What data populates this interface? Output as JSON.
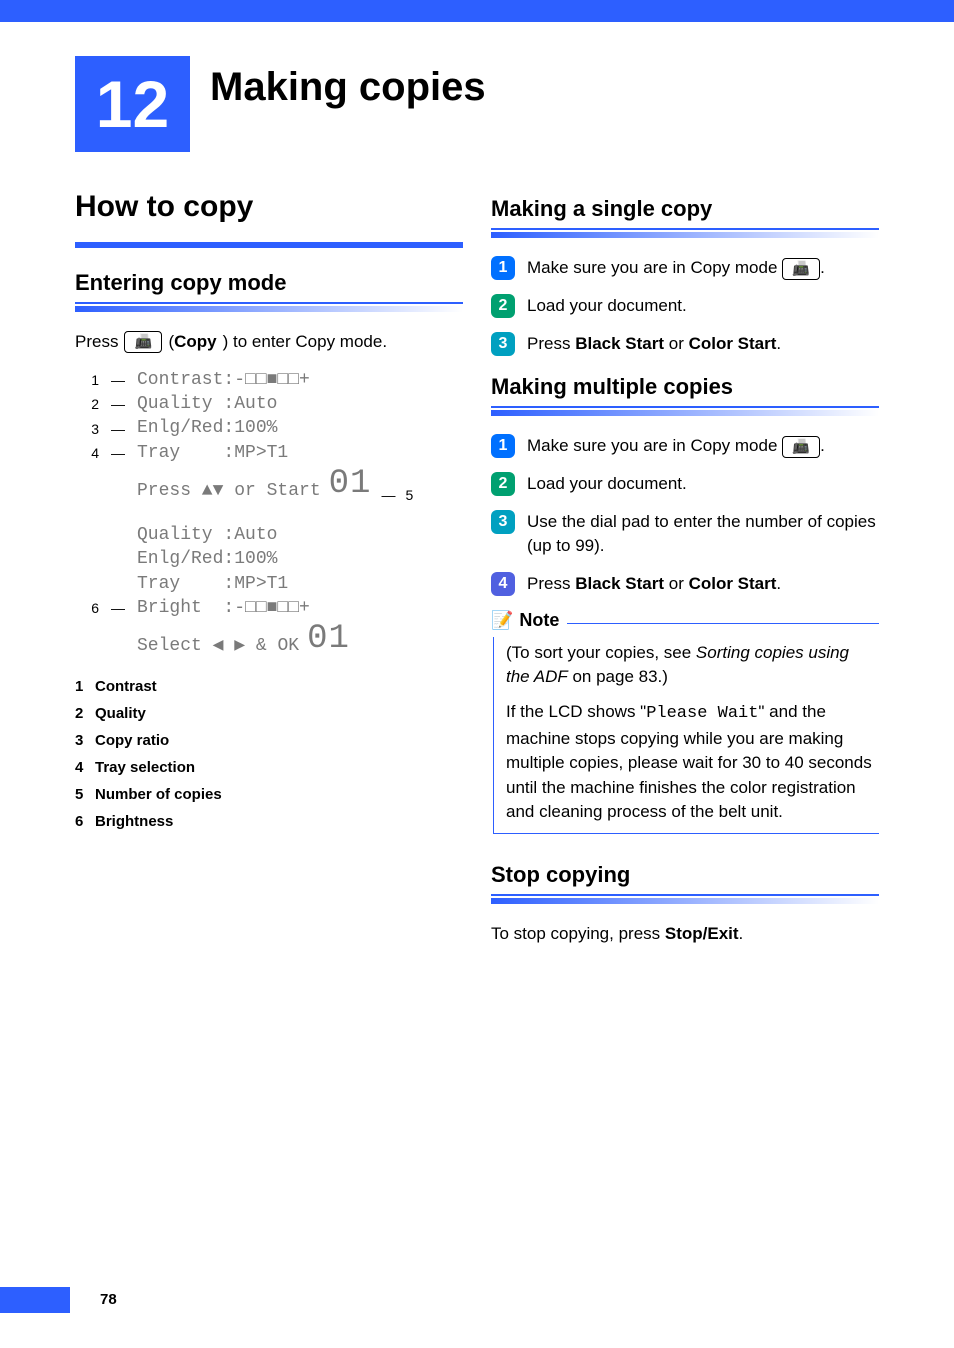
{
  "chapter": {
    "number": "12",
    "title": "Making copies"
  },
  "page_number": "78",
  "left": {
    "section_title": "How to copy",
    "sub1_title": "Entering copy mode",
    "press_pre": "Press",
    "press_copy_label": "Copy",
    "press_post": ") to enter Copy mode.",
    "lcd1": {
      "c1": "1",
      "l1": "Contrast:-□□■□□+",
      "c2": "2",
      "l2": "Quality :Auto",
      "c3": "3",
      "l3": "Enlg/Red:100%",
      "c4": "4",
      "l4": "Tray    :MP>T1",
      "footer": "Press ▲▼ or Start",
      "big": "01",
      "c5": "5"
    },
    "lcd2": {
      "l1": "Quality :Auto",
      "l2": "Enlg/Red:100%",
      "l3": "Tray    :MP>T1",
      "c6": "6",
      "l4": "Bright  :-□□■□□+",
      "footer": "Select ◀ ▶ & OK",
      "big": "01"
    },
    "legend": {
      "i1n": "1",
      "i1": "Contrast",
      "i2n": "2",
      "i2": "Quality",
      "i3n": "3",
      "i3": "Copy ratio",
      "i4n": "4",
      "i4": "Tray selection",
      "i5n": "5",
      "i5": "Number of copies",
      "i6n": "6",
      "i6": "Brightness"
    }
  },
  "right": {
    "sub1_title": "Making a single copy",
    "s1_1": "Make sure you are in Copy mode",
    "s1_1_tail": ".",
    "s1_2": "Load your document.",
    "s1_3_pre": "Press ",
    "s1_3_b1": "Black Start",
    "s1_3_mid": " or ",
    "s1_3_b2": "Color Start",
    "s1_3_post": ".",
    "sub2_title": "Making multiple copies",
    "s2_1": "Make sure you are in Copy mode",
    "s2_1_tail": ".",
    "s2_2": "Load your document.",
    "s2_3": "Use the dial pad to enter the number of copies (up to 99).",
    "s2_4_pre": "Press ",
    "s2_4_b1": "Black Start",
    "s2_4_mid": " or ",
    "s2_4_b2": "Color Start",
    "s2_4_post": ".",
    "note_label": "Note",
    "note_p1_pre": "(To sort your copies, see ",
    "note_p1_em": "Sorting copies using the ADF",
    "note_p1_post": " on page 83.)",
    "note_p2_pre": "If the LCD shows \"",
    "note_p2_mono": "Please Wait",
    "note_p2_post": "\" and the machine stops copying while you are making multiple copies, please wait for 30 to 40 seconds until the machine finishes the color registration and cleaning process of the belt unit.",
    "sub3_title": "Stop copying",
    "stop_pre": "To stop copying, press ",
    "stop_bold": "Stop/Exit",
    "stop_post": "."
  }
}
